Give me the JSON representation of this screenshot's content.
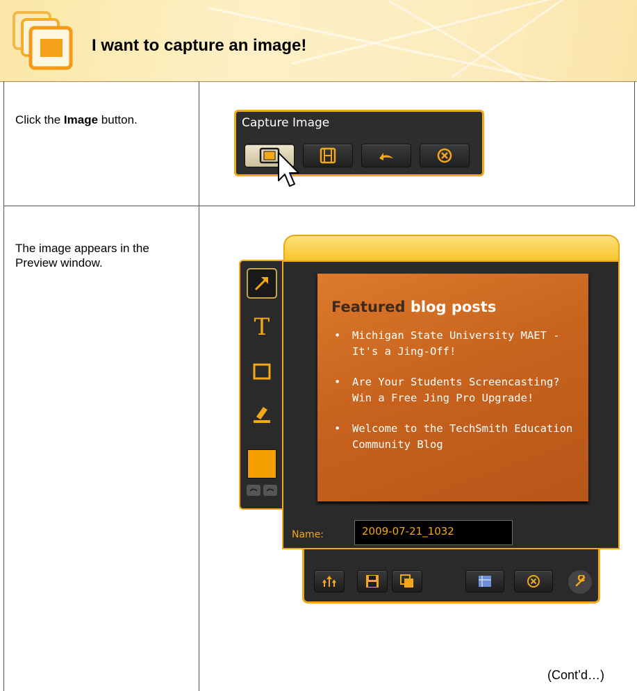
{
  "header": {
    "title": "I want to capture an image!"
  },
  "steps": [
    {
      "prefix": "Click the ",
      "bold": "Image",
      "suffix": " button."
    },
    {
      "text": "The image appears in the Preview window."
    }
  ],
  "capture_toolbar": {
    "title": "Capture Image",
    "buttons": [
      "image-icon",
      "video-icon",
      "redo-icon",
      "cancel-icon"
    ],
    "active_button": "image-icon"
  },
  "preview": {
    "tools": [
      "arrow-icon",
      "text-icon",
      "frame-icon",
      "highlight-icon",
      "color-swatch"
    ],
    "image": {
      "title_part1": "Featured",
      "title_part2": "blog posts",
      "items": [
        "Michigan State University MAET - It's a Jing-Off!",
        "Are Your Students Screencasting? Win a Free Jing Pro Upgrade!",
        "Welcome to the TechSmith Education Community Blog"
      ]
    },
    "name_label": "Name:",
    "name_value": "2009-07-21_1032",
    "bottom_buttons": [
      "share-icon",
      "save-icon",
      "copy-icon",
      "capture-history-icon",
      "cancel-icon",
      "settings-icon"
    ]
  },
  "footer": {
    "contd": "(Cont’d…)"
  },
  "colors": {
    "accent": "#f2a818",
    "dark": "#2a2a2a",
    "orange": "#c7631d"
  }
}
